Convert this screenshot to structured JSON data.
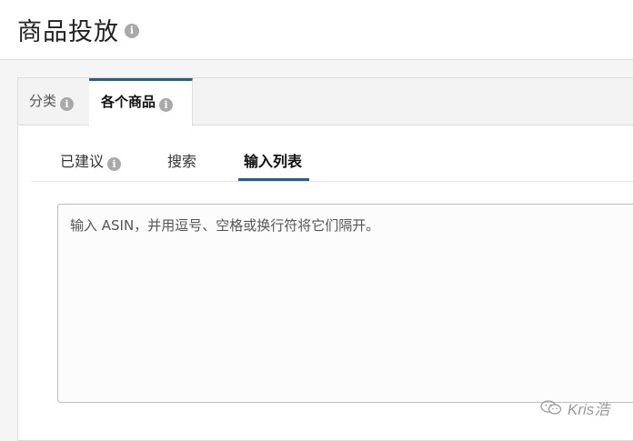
{
  "header": {
    "title": "商品投放",
    "info_glyph": "i"
  },
  "tabs": [
    {
      "label": "分类",
      "info_glyph": "i",
      "active": false
    },
    {
      "label": "各个商品",
      "info_glyph": "i",
      "active": true
    }
  ],
  "subtabs": [
    {
      "label": "已建议",
      "info_glyph": "i",
      "active": false
    },
    {
      "label": "搜索",
      "active": false
    },
    {
      "label": "输入列表",
      "active": true
    }
  ],
  "asin_input": {
    "value": "",
    "placeholder": "输入 ASIN，并用逗号、空格或换行符将它们隔开。"
  },
  "watermark": {
    "text": "Kris浩",
    "icon": "wechat-icon"
  },
  "colors": {
    "accent": "#2e5d7e",
    "info_icon": "#a9a9a9",
    "border": "#dcdcdc"
  }
}
